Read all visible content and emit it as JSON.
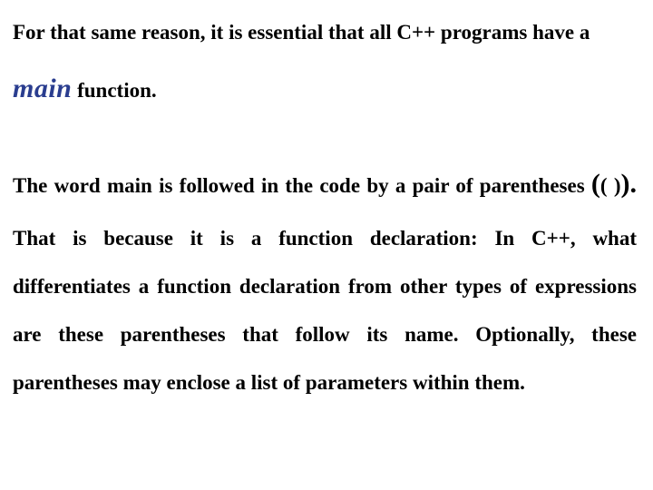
{
  "para1": {
    "t1": "For that same reason, it is essential that all C++ programs have a ",
    "main": "main",
    "t2": " function."
  },
  "para2": {
    "t1": "The word main is followed in the code by a pair of parentheses ",
    "parens_outer_open": "(",
    "parens_inner": "( )",
    "parens_outer_close": ").",
    "t2": " That is because it is a function declaration: In C++, what differentiates a function declaration from other types of expressions are these parentheses that follow its name. Optionally, these parentheses may enclose a list of parameters within them."
  }
}
